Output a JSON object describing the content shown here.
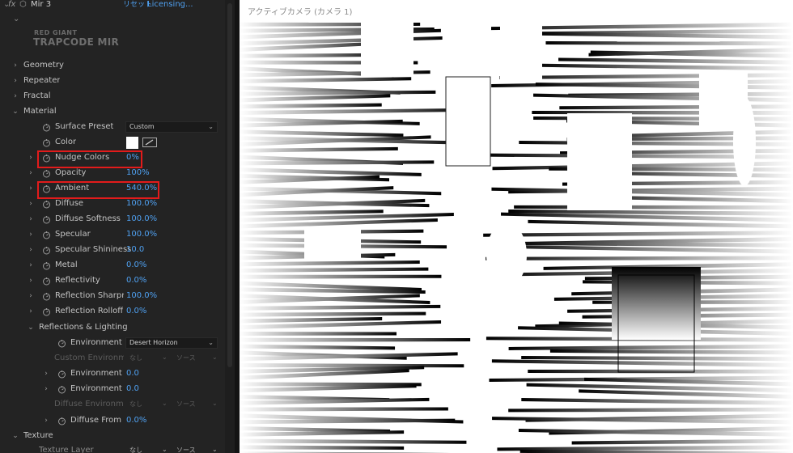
{
  "header": {
    "fx": "fx",
    "layer_name": "Mir 3",
    "reset_label": "リセット",
    "licensing_label": "Licensing..."
  },
  "logo": {
    "line1": "RED GIANT",
    "line2": "TRAPCODE MIR"
  },
  "groups": {
    "geometry": "Geometry",
    "repeater": "Repeater",
    "fractal": "Fractal",
    "material": "Material",
    "reflections": "Reflections & Lighting",
    "texture": "Texture"
  },
  "material": {
    "surface_preset": {
      "label": "Surface Preset",
      "value": "Custom"
    },
    "color": {
      "label": "Color",
      "swatch": "#ffffff"
    },
    "nudge_colors": {
      "label": "Nudge Colors",
      "value": "0%"
    },
    "opacity": {
      "label": "Opacity",
      "value": "100%"
    },
    "ambient": {
      "label": "Ambient",
      "value": "540.0%"
    },
    "diffuse": {
      "label": "Diffuse",
      "value": "100.0%"
    },
    "diffuse_softness": {
      "label": "Diffuse Softness",
      "value": "100.0%"
    },
    "specular": {
      "label": "Specular",
      "value": "100.0%"
    },
    "specular_shininess": {
      "label": "Specular Shininess",
      "value": "10.0"
    },
    "metal": {
      "label": "Metal",
      "value": "0.0%"
    },
    "reflectivity": {
      "label": "Reflectivity",
      "value": "0.0%"
    },
    "reflection_sharpness": {
      "label": "Reflection Sharpne",
      "value": "100.0%"
    },
    "reflection_rolloff": {
      "label": "Reflection Rolloff",
      "value": "0.0%"
    }
  },
  "reflections": {
    "environment_map": {
      "label": "Environment M",
      "value": "Desert Horizon"
    },
    "custom_environment": {
      "label": "Custom Environme",
      "value1": "なし",
      "value2": "ソース"
    },
    "environment_e": {
      "label": "Environment E",
      "value": "0.0"
    },
    "environment_y": {
      "label": "Environment Y",
      "value": "0.0"
    },
    "diffuse_environment": {
      "label": "Diffuse Environmen",
      "value1": "なし",
      "value2": "ソース"
    },
    "diffuse_from_e": {
      "label": "Diffuse From E",
      "value": "0.0%"
    }
  },
  "texture": {
    "texture_layer": {
      "label": "Texture Layer",
      "value1": "なし",
      "value2": "ソース"
    }
  },
  "viewer": {
    "title": "アクティブカメラ (カメラ 1)"
  },
  "colors": {
    "accent_blue": "#4fa0f0",
    "highlight_red": "#e21b1b",
    "panel_bg": "#232323"
  }
}
